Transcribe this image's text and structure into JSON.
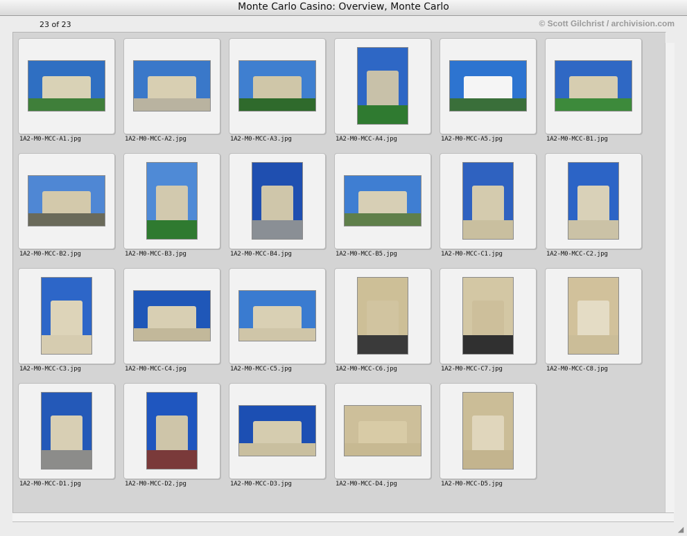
{
  "window": {
    "title": "Monte Carlo Casino: Overview, Monte Carlo"
  },
  "header": {
    "count": "23 of 23",
    "copyright": "© Scott Gilchrist / archivision.com"
  },
  "items": [
    {
      "filename": "1A2-M0-MCC-A1.jpg",
      "orientation": "landscape",
      "sky": "#2f6fc2",
      "ground": "#3f7f3a",
      "bldg": "#d9d2b6"
    },
    {
      "filename": "1A2-M0-MCC-A2.jpg",
      "orientation": "landscape",
      "sky": "#3a78c9",
      "ground": "#b9b3a0",
      "bldg": "#d8cfb2"
    },
    {
      "filename": "1A2-M0-MCC-A3.jpg",
      "orientation": "landscape",
      "sky": "#3f7fd0",
      "ground": "#2f6a2c",
      "bldg": "#cfc6a8"
    },
    {
      "filename": "1A2-M0-MCC-A4.jpg",
      "orientation": "portrait",
      "sky": "#2e67c5",
      "ground": "#2f7a30",
      "bldg": "#c8c1a9"
    },
    {
      "filename": "1A2-M0-MCC-A5.jpg",
      "orientation": "landscape",
      "sky": "#2d74d0",
      "ground": "#3a6f3a",
      "bldg": "#f5f5f5"
    },
    {
      "filename": "1A2-M0-MCC-B1.jpg",
      "orientation": "landscape",
      "sky": "#2f68c4",
      "ground": "#3d8a3b",
      "bldg": "#d6cdb0"
    },
    {
      "filename": "1A2-M0-MCC-B2.jpg",
      "orientation": "landscape",
      "sky": "#4f87d4",
      "ground": "#6a6a5a",
      "bldg": "#d3c9ab"
    },
    {
      "filename": "1A2-M0-MCC-B3.jpg",
      "orientation": "portrait",
      "sky": "#4f8ad6",
      "ground": "#2f7a30",
      "bldg": "#d2c9ae"
    },
    {
      "filename": "1A2-M0-MCC-B4.jpg",
      "orientation": "portrait",
      "sky": "#1f4fb0",
      "ground": "#8a8f95",
      "bldg": "#cfc6aa"
    },
    {
      "filename": "1A2-M0-MCC-B5.jpg",
      "orientation": "landscape",
      "sky": "#3f7ed2",
      "ground": "#5f7f4a",
      "bldg": "#d7cfb5"
    },
    {
      "filename": "1A2-M0-MCC-C1.jpg",
      "orientation": "portrait",
      "sky": "#2f62c0",
      "ground": "#c9bf9f",
      "bldg": "#d4cbae"
    },
    {
      "filename": "1A2-M0-MCC-C2.jpg",
      "orientation": "portrait",
      "sky": "#2c64c6",
      "ground": "#cbc2a6",
      "bldg": "#d9d1b8"
    },
    {
      "filename": "1A2-M0-MCC-C3.jpg",
      "orientation": "portrait",
      "sky": "#2d66c8",
      "ground": "#d6ccb0",
      "bldg": "#ddd4b9"
    },
    {
      "filename": "1A2-M0-MCC-C4.jpg",
      "orientation": "landscape",
      "sky": "#1f57b8",
      "ground": "#c2b89a",
      "bldg": "#d8cfb3"
    },
    {
      "filename": "1A2-M0-MCC-C5.jpg",
      "orientation": "landscape",
      "sky": "#3a7bd0",
      "ground": "#cfc5a8",
      "bldg": "#d9d0b4"
    },
    {
      "filename": "1A2-M0-MCC-C6.jpg",
      "orientation": "portrait",
      "sky": "#cdbf97",
      "ground": "#3a3a3a",
      "bldg": "#d1c4a0"
    },
    {
      "filename": "1A2-M0-MCC-C7.jpg",
      "orientation": "portrait",
      "sky": "#d3c7a4",
      "ground": "#303030",
      "bldg": "#cdbf9b"
    },
    {
      "filename": "1A2-M0-MCC-C8.jpg",
      "orientation": "portrait",
      "sky": "#d1c19b",
      "ground": "#cbbd98",
      "bldg": "#e4dcc5"
    },
    {
      "filename": "1A2-M0-MCC-D1.jpg",
      "orientation": "portrait",
      "sky": "#2459b8",
      "ground": "#8c8c8a",
      "bldg": "#d8cfb4"
    },
    {
      "filename": "1A2-M0-MCC-D2.jpg",
      "orientation": "portrait",
      "sky": "#1f56bf",
      "ground": "#7a3a3a",
      "bldg": "#cec5a9"
    },
    {
      "filename": "1A2-M0-MCC-D3.jpg",
      "orientation": "landscape",
      "sky": "#1c4fb3",
      "ground": "#c9bf9f",
      "bldg": "#d5ccaf"
    },
    {
      "filename": "1A2-M0-MCC-D4.jpg",
      "orientation": "landscape",
      "sky": "#cdbf9a",
      "ground": "#c7b992",
      "bldg": "#d8cba6"
    },
    {
      "filename": "1A2-M0-MCC-D5.jpg",
      "orientation": "portrait",
      "sky": "#cbbd97",
      "ground": "#c3b48e",
      "bldg": "#e0d6bc"
    }
  ]
}
